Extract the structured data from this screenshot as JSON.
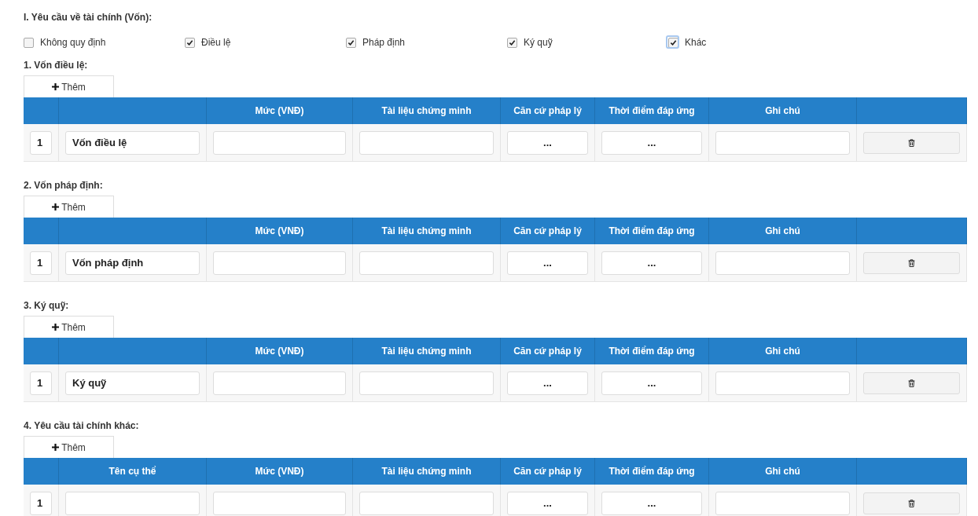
{
  "heading": "I. Yêu cầu về tài chính (Vốn):",
  "options": [
    {
      "label": "Không quy định",
      "checked": false,
      "focused": false
    },
    {
      "label": "Điều lệ",
      "checked": true,
      "focused": false
    },
    {
      "label": "Pháp định",
      "checked": true,
      "focused": false
    },
    {
      "label": "Ký quỹ",
      "checked": true,
      "focused": false
    },
    {
      "label": "Khác",
      "checked": true,
      "focused": true
    }
  ],
  "sections": [
    {
      "title": "1. Vốn điều lệ:",
      "add_button": "Thêm",
      "columns": [
        "",
        "Mức (VNĐ)",
        "Tài liệu chứng minh",
        "Căn cứ pháp lý",
        "Thời điểm đáp ứng",
        "Ghi chú"
      ],
      "rows": [
        {
          "index": "1",
          "name": "Vốn điều lệ",
          "legal_basis": "...",
          "deadline": "..."
        }
      ]
    },
    {
      "title": "2. Vốn pháp định:",
      "add_button": "Thêm",
      "columns": [
        "",
        "Mức (VNĐ)",
        "Tài liệu chứng minh",
        "Căn cứ pháp lý",
        "Thời điểm đáp ứng",
        "Ghi chú"
      ],
      "rows": [
        {
          "index": "1",
          "name": "Vốn pháp định",
          "legal_basis": "...",
          "deadline": "..."
        }
      ]
    },
    {
      "title": "3. Ký quỹ:",
      "add_button": "Thêm",
      "columns": [
        "",
        "Mức (VNĐ)",
        "Tài liệu chứng minh",
        "Căn cứ pháp lý",
        "Thời điểm đáp ứng",
        "Ghi chú"
      ],
      "rows": [
        {
          "index": "1",
          "name": "Ký quỹ",
          "legal_basis": "...",
          "deadline": "..."
        }
      ]
    },
    {
      "title": "4. Yêu cầu tài chính khác:",
      "add_button": "Thêm",
      "columns": [
        "Tên cụ thể",
        "Mức (VNĐ)",
        "Tài liệu chứng minh",
        "Căn cứ pháp lý",
        "Thời điểm đáp ứng",
        "Ghi chú"
      ],
      "rows": [
        {
          "index": "1",
          "name": "",
          "legal_basis": "...",
          "deadline": "..."
        }
      ]
    }
  ]
}
